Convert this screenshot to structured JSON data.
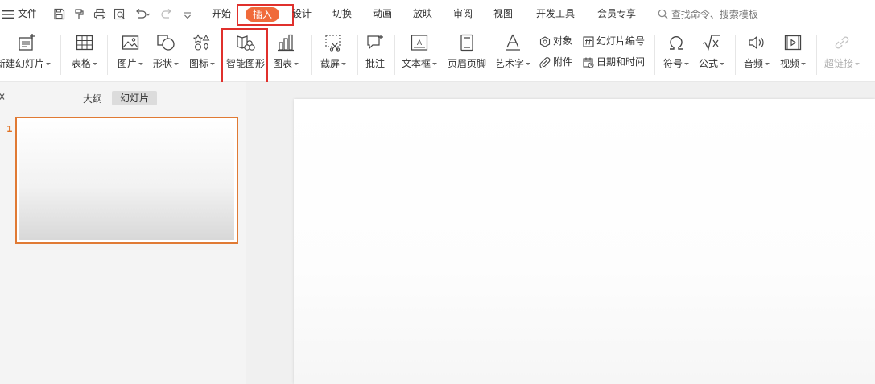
{
  "menubar": {
    "file": "文件",
    "tabs": [
      "开始",
      "插入",
      "设计",
      "切换",
      "动画",
      "放映",
      "审阅",
      "视图",
      "开发工具",
      "会员专享"
    ],
    "search_placeholder": "查找命令、搜索模板"
  },
  "ribbon": {
    "new_slide": "新建幻灯片",
    "table": "表格",
    "picture": "图片",
    "shape": "形状",
    "icon": "图标",
    "smart_graphic": "智能图形",
    "chart": "图表",
    "screenshot": "截屏",
    "comment": "批注",
    "textbox": "文本框",
    "header_footer": "页眉页脚",
    "wordart": "艺术字",
    "object": "对象",
    "attachment": "附件",
    "slide_number": "幻灯片编号",
    "date_time": "日期和时间",
    "symbol": "符号",
    "formula": "公式",
    "audio": "音频",
    "video": "视频",
    "hyperlink": "超链接"
  },
  "left_panel": {
    "tab_outline": "大纲",
    "tab_slides": "幻灯片",
    "slide_number": "1"
  },
  "colors": {
    "accent": "#f06a3a",
    "highlight_box": "#e0302c",
    "thumb_border": "#e07a34"
  }
}
